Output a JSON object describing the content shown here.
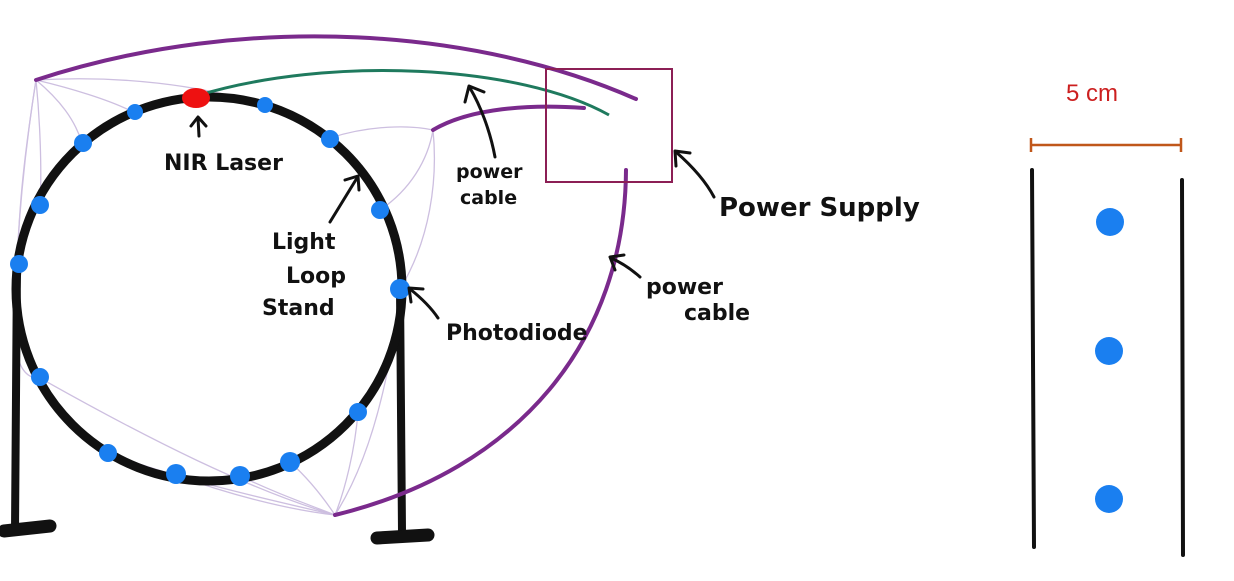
{
  "labels": {
    "nir_laser": "NIR Laser",
    "power_cable_top_line1": "power",
    "power_cable_top_line2": "cable",
    "power_supply": "Power Supply",
    "light_loop_stand_line1": "Light",
    "light_loop_stand_line2": "Loop",
    "light_loop_stand_line3": "Stand",
    "photodiode": "Photodiode",
    "power_cable_right_line1": "power",
    "power_cable_right_line2": "cable"
  },
  "scale": {
    "label": "5 cm"
  },
  "colors": {
    "loop": "#111111",
    "photodiode": "#1a7ff0",
    "laser": "#ee1111",
    "power_cable": "#7a2a8c",
    "laser_fiber": "#1f7a5e",
    "thin_wires": "#cdbfe0",
    "power_supply_box": "#8c1f55",
    "scale_label": "#cc1f1f",
    "scale_bar": "#c0571a"
  },
  "icons": {
    "photodiode": "blue-dot",
    "laser": "red-ellipse",
    "arrow": "hand-drawn-arrow"
  }
}
